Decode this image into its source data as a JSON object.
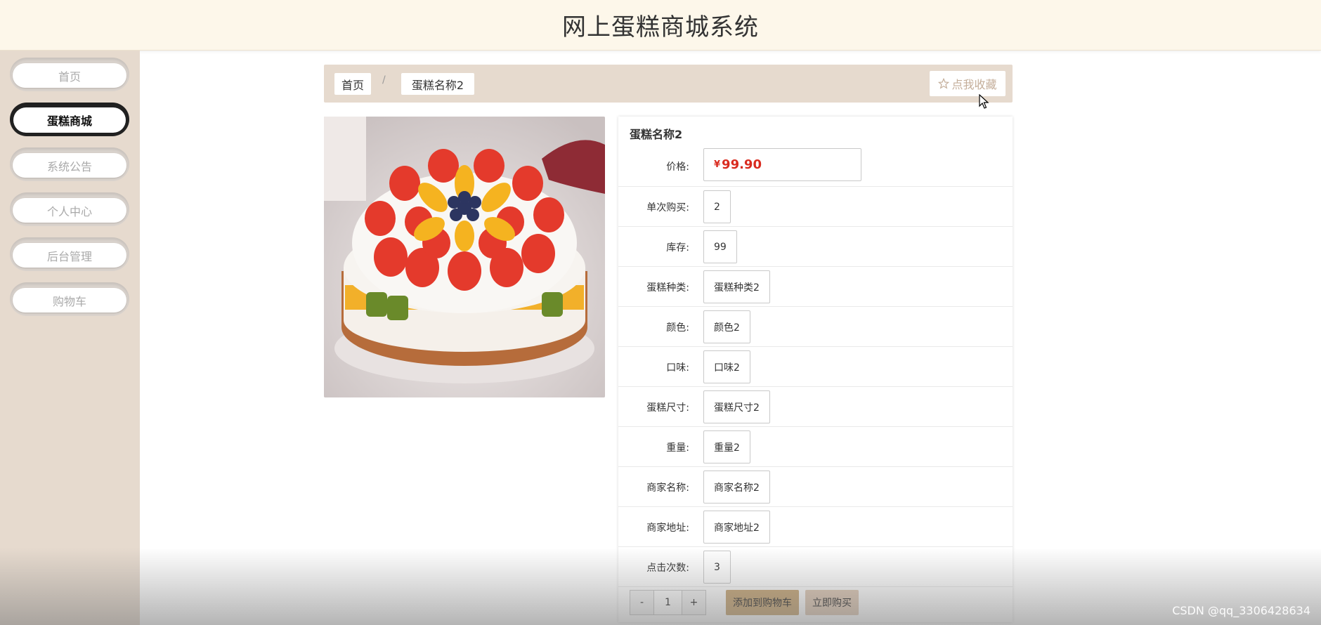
{
  "app": {
    "title": "网上蛋糕商城系统"
  },
  "sidebar": {
    "items": [
      {
        "label": "首页",
        "active": false
      },
      {
        "label": "蛋糕商城",
        "active": true
      },
      {
        "label": "系统公告",
        "active": false
      },
      {
        "label": "个人中心",
        "active": false
      },
      {
        "label": "后台管理",
        "active": false
      },
      {
        "label": "购物车",
        "active": false
      }
    ]
  },
  "breadcrumb": {
    "home": "首页",
    "separator": "/",
    "current": "蛋糕名称2"
  },
  "favorite": {
    "icon": "star-outline-icon",
    "label": "点我收藏"
  },
  "product": {
    "name": "蛋糕名称2",
    "price_label": "价格:",
    "currency_symbol": "¥",
    "price": "99.90",
    "fields": [
      {
        "label": "单次购买:",
        "value": "2"
      },
      {
        "label": "库存:",
        "value": "99"
      },
      {
        "label": "蛋糕种类:",
        "value": "蛋糕种类2"
      },
      {
        "label": "颜色:",
        "value": "颜色2"
      },
      {
        "label": "口味:",
        "value": "口味2"
      },
      {
        "label": "蛋糕尺寸:",
        "value": "蛋糕尺寸2"
      },
      {
        "label": "重量:",
        "value": "重量2"
      },
      {
        "label": "商家名称:",
        "value": "商家名称2"
      },
      {
        "label": "商家地址:",
        "value": "商家地址2"
      },
      {
        "label": "点击次数:",
        "value": "3"
      }
    ]
  },
  "actions": {
    "decrement": "-",
    "quantity": "1",
    "increment": "+",
    "add_to_cart": "添加到购物车",
    "buy_now": "立即购买"
  },
  "watermark": "CSDN @qq_3306428634",
  "colors": {
    "header_bg": "#fdf7ea",
    "sidebar_bg": "#e6dace",
    "price": "#d92b1f",
    "add_to_cart_bg": "#c9a97a",
    "buy_now_bg": "#e0cbb8"
  }
}
